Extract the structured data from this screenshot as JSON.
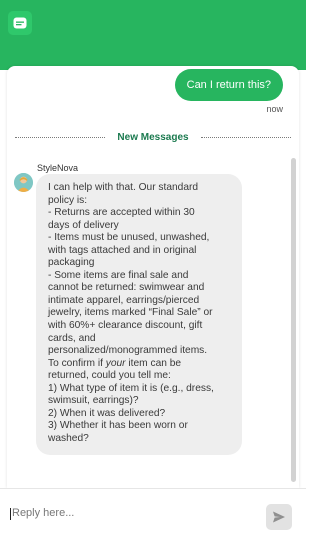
{
  "header": {
    "brand_icon": "chat-bubble-icon",
    "accent_color": "#27b55f"
  },
  "conversation": {
    "user_message": "Can I return this?",
    "user_timestamp": "now",
    "divider_label": "New Messages",
    "bot_name": "StyleNova",
    "bot_message_lines": [
      "I can help with that. Our standard",
      "policy is:",
      "- Returns are accepted within 30",
      "days of delivery",
      "- Items must be unused, unwashed,",
      "with tags attached and in original",
      "packaging",
      "- Some items are final sale and",
      "cannot be returned: swimwear and",
      "intimate apparel, earrings/pierced",
      "jewelry, items marked “Final Sale” or",
      "with 60%+ clearance discount, gift",
      "cards, and",
      "personalized/monogrammed items.",
      "To confirm if your item can be",
      "returned, could you tell me:",
      "1) What type of item it is (e.g., dress,",
      "swimsuit, earrings)?",
      "2) When it was delivered?",
      "3) Whether it has been worn or",
      "washed?"
    ]
  },
  "composer": {
    "placeholder": "Reply here...",
    "send_icon": "send-icon"
  }
}
